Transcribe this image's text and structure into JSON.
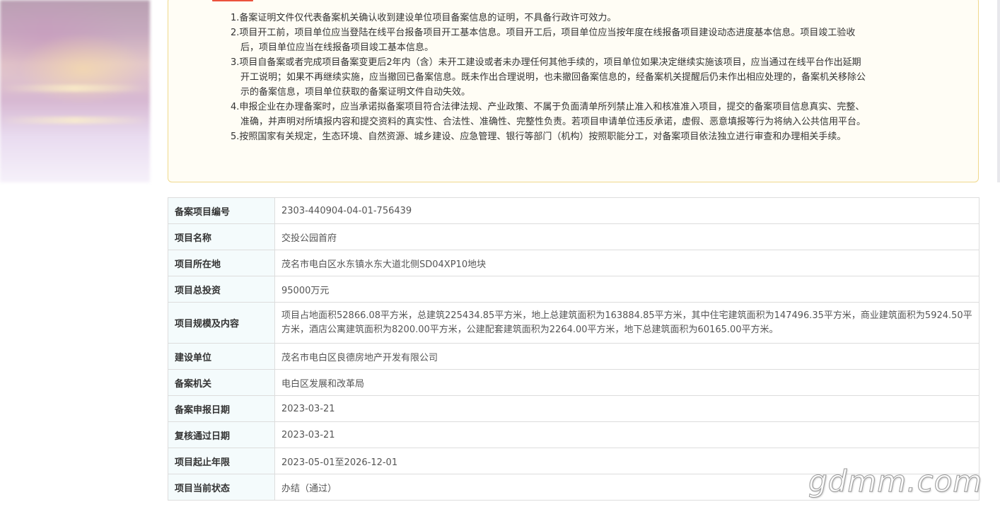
{
  "notice": {
    "items": [
      "1.备案证明文件仅代表备案机关确认收到建设单位项目备案信息的证明，不具备行政许可效力。",
      "2.项目开工前，项目单位应当登陆在线平台报备项目开工基本信息。项目开工后，项目单位应当按年度在线报备项目建设动态进度基本信息。项目竣工验收后，项目单位应当在线报备项目竣工基本信息。",
      "3.项目自备案或者完成项目备案变更后2年内（含）未开工建设或者未办理任何其他手续的，项目单位如果决定继续实施该项目，应当通过在线平台作出延期开工说明；如果不再继续实施，应当撤回已备案信息。既未作出合理说明，也未撤回备案信息的，经备案机关提醒后仍未作出相应处理的，备案机关移除公示的备案信息，项目单位获取的备案证明文件自动失效。",
      "4.申报企业在办理备案时，应当承诺拟备案项目符合法律法规、产业政策、不属于负面清单所列禁止准入和核准准入项目，提交的备案项目信息真实、完整、准确，并声明对所填报内容和提交资料的真实性、合法性、准确性、完整性负责。若项目申请单位违反承诺，虚假、恶意填报等行为将纳入公共信用平台。",
      "5.按照国家有关规定，生态环境、自然资源、城乡建设、应急管理、银行等部门（机构）按照职能分工，对备案项目依法独立进行审查和办理相关手续。"
    ]
  },
  "table": {
    "rows": [
      {
        "label": "备案项目编号",
        "value": "2303-440904-04-01-756439"
      },
      {
        "label": "项目名称",
        "value": "交投公园首府"
      },
      {
        "label": "项目所在地",
        "value": "茂名市电白区水东镇水东大道北侧SD04XP10地块"
      },
      {
        "label": "项目总投资",
        "value": "95000万元"
      },
      {
        "label": "项目规模及内容",
        "value": "项目占地面积52866.08平方米，总建筑225434.85平方米，地上总建筑面积为163884.85平方米，其中住宅建筑面积为147496.35平方米，商业建筑面积为5924.50平方米，酒店公寓建筑面积为8200.00平方米，公建配套建筑面积为2264.00平方米，地下总建筑面积为60165.00平方米。"
      },
      {
        "label": "建设单位",
        "value": "茂名市电白区良德房地产开发有限公司"
      },
      {
        "label": "备案机关",
        "value": "电白区发展和改革局"
      },
      {
        "label": "备案申报日期",
        "value": "2023-03-21"
      },
      {
        "label": "复核通过日期",
        "value": "2023-03-21"
      },
      {
        "label": "项目起止年限",
        "value": "2023-05-01至2026-12-01"
      },
      {
        "label": "项目当前状态",
        "value": "办结（通过）"
      }
    ]
  },
  "watermark": {
    "text": "gdmm.com"
  },
  "colors": {
    "notice_border": "#f0d98c",
    "notice_bg": "#fffdf5",
    "label_bg": "#f4fbfc",
    "table_border": "#dddddd",
    "title_red": "#e8341c"
  }
}
